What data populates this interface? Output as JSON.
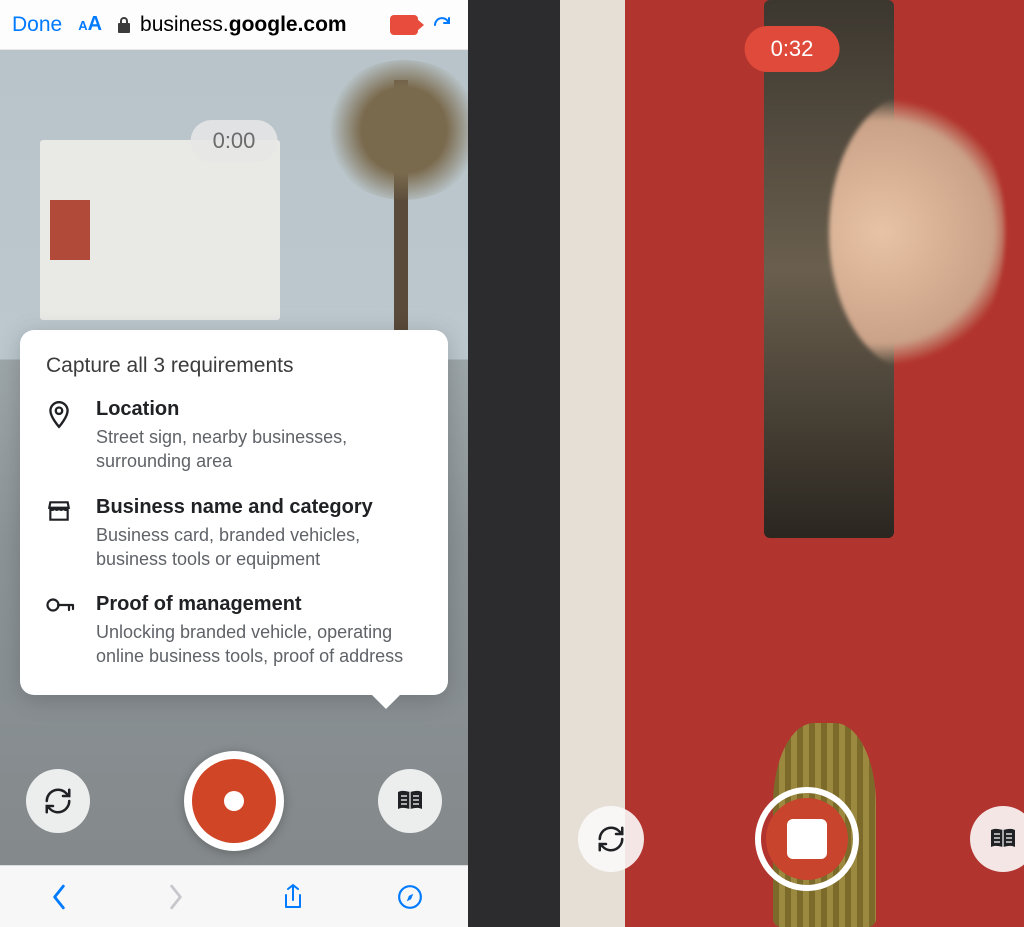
{
  "left": {
    "addressBar": {
      "done": "Done",
      "host_plain": "business.",
      "host_bold": "google.com"
    },
    "timer": "0:00",
    "tip": {
      "title": "Capture all 3 requirements",
      "items": [
        {
          "label": "Location",
          "desc": "Street sign, nearby businesses, surrounding area"
        },
        {
          "label": "Business name and category",
          "desc": "Business card, branded vehicles, business tools or equipment"
        },
        {
          "label": "Proof of management",
          "desc": "Unlocking branded vehicle, operating online business tools, proof of address"
        }
      ]
    }
  },
  "right": {
    "timer": "0:32"
  }
}
